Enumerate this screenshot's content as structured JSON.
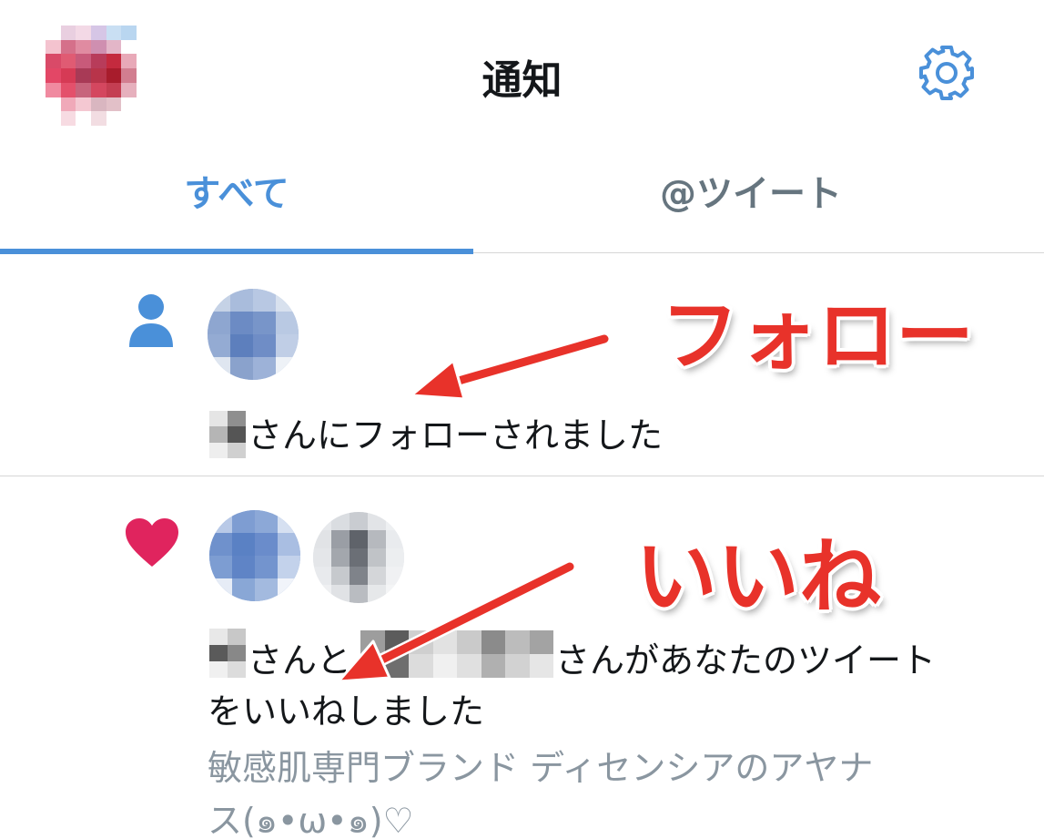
{
  "header": {
    "title": "通知",
    "settings_icon": "gear-icon"
  },
  "tabs": [
    {
      "label": "すべて",
      "active": true
    },
    {
      "label": "@ツイート",
      "active": false
    }
  ],
  "notifications": [
    {
      "type": "follow",
      "icon": "person-icon",
      "text": "さんにフォローされました"
    },
    {
      "type": "like",
      "icon": "heart-icon",
      "text_part1": "さんと",
      "text_part2": "さんがあなたのツイート",
      "text_line2": "をいいねしました",
      "quote_line1": "敏感肌専門ブランド ディセンシアのアヤナ",
      "quote_line2": "ス(๑•ω•๑)♡"
    }
  ],
  "annotations": {
    "follow": "フォロー",
    "like": "いいね"
  },
  "colors": {
    "accent": "#4a90d9",
    "like": "#e0245e",
    "annotation": "#e8322a"
  }
}
